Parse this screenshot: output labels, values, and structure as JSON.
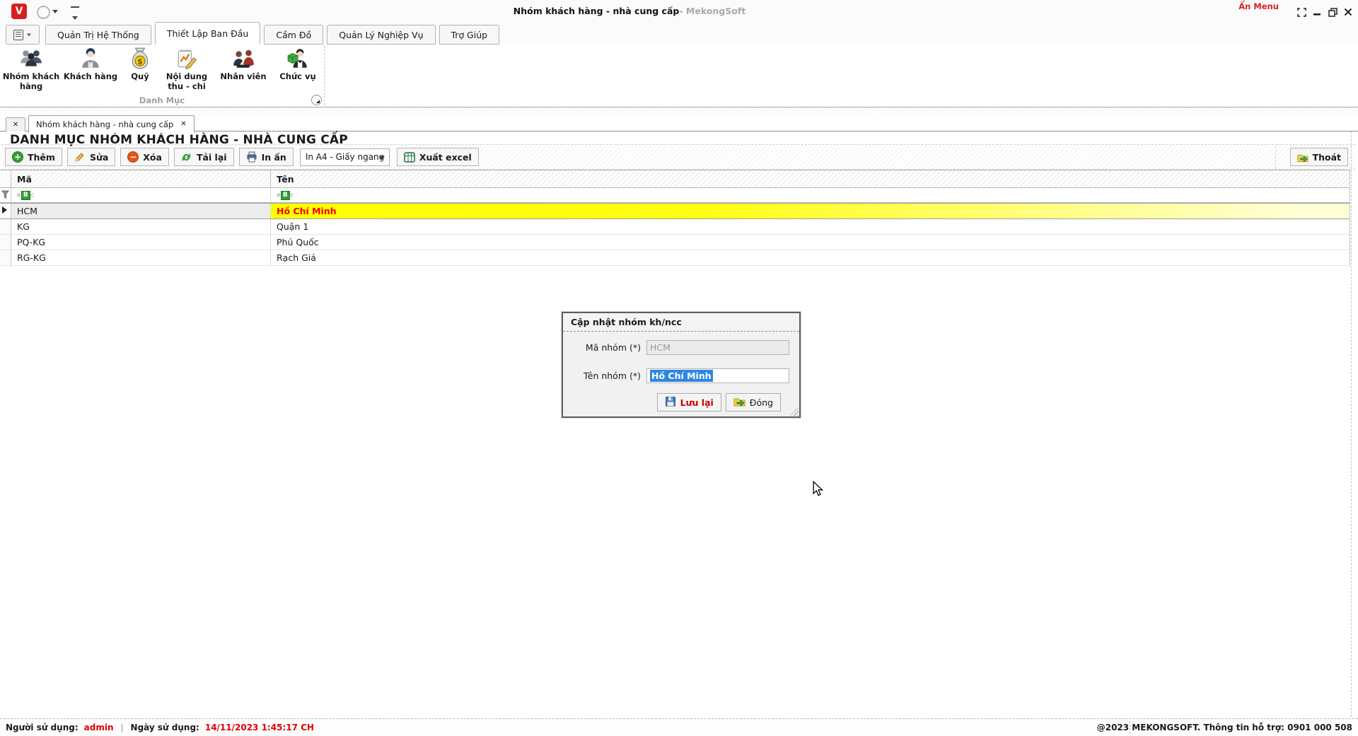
{
  "titlebar": {
    "logo_letter": "V",
    "title": "Nhóm khách hàng - nhà cung cấp",
    "brand": " - MekongSoft",
    "hide_menu_label": "Ẩn Menu"
  },
  "ribbon": {
    "tabs": [
      {
        "label": "Quản Trị Hệ Thống"
      },
      {
        "label": "Thiết Lập Ban Đầu"
      },
      {
        "label": "Cầm Đồ"
      },
      {
        "label": "Quản Lý Nghiệp Vụ"
      },
      {
        "label": "Trợ Giúp"
      }
    ],
    "active_tab": "Thiết Lập Ban Đầu",
    "items": [
      {
        "label": "Nhóm khách hàng"
      },
      {
        "label": "Khách hàng"
      },
      {
        "label": "Quỹ"
      },
      {
        "label": "Nội dung thu - chi"
      },
      {
        "label": "Nhân viên"
      },
      {
        "label": "Chức vụ"
      }
    ],
    "group_label": "Danh Mục"
  },
  "doc_tab": {
    "label": "Nhóm khách hàng - nhà cung cấp",
    "close_glyph": "✕"
  },
  "page": {
    "heading": "DANH MỤC NHÓM KHÁCH HÀNG - NHÀ CUNG CẤP"
  },
  "toolbar": {
    "add": "Thêm",
    "edit": "Sửa",
    "delete": "Xóa",
    "reload": "Tải lại",
    "print": "In ấn",
    "print_option": "In A4 - Giấy ngang",
    "export": "Xuất excel",
    "exit": "Thoát"
  },
  "grid": {
    "columns": [
      {
        "label": "Mã"
      },
      {
        "label": "Tên"
      }
    ],
    "filter_icon": {
      "a": "a",
      "b": "B",
      "c": "c"
    },
    "rows": [
      {
        "ma": "HCM",
        "ten": "Hồ Chí Minh",
        "selected": true
      },
      {
        "ma": "KG",
        "ten": "Quận 1",
        "selected": false
      },
      {
        "ma": "PQ-KG",
        "ten": "Phú Quốc",
        "selected": false
      },
      {
        "ma": "RG-KG",
        "ten": "Rạch Giá",
        "selected": false
      }
    ]
  },
  "dialog": {
    "title": "Cập nhật nhóm kh/ncc",
    "code_label": "Mã nhóm (*)",
    "code_value": "HCM",
    "name_label": "Tên nhóm (*)",
    "name_value": "Hồ Chí Minh",
    "save_label": "Lưu lại",
    "close_label": "Đóng"
  },
  "statusbar": {
    "user_label": "Người sử dụng:",
    "user_value": "admin",
    "pipe": "|",
    "date_label": "Ngày sử dụng:",
    "date_value": "14/11/2023 1:45:17 CH",
    "copyright": "@2023 MEKONGSOFT. Thông tin hỗ trợ: 0901 000 508"
  },
  "colors": {
    "brand_red": "#d6201f",
    "selected_row_yellow": "#ffff00",
    "selected_row_text": "#f30000",
    "status_value_red": "#e00000",
    "filter_icon_green": "#2fa12f"
  }
}
